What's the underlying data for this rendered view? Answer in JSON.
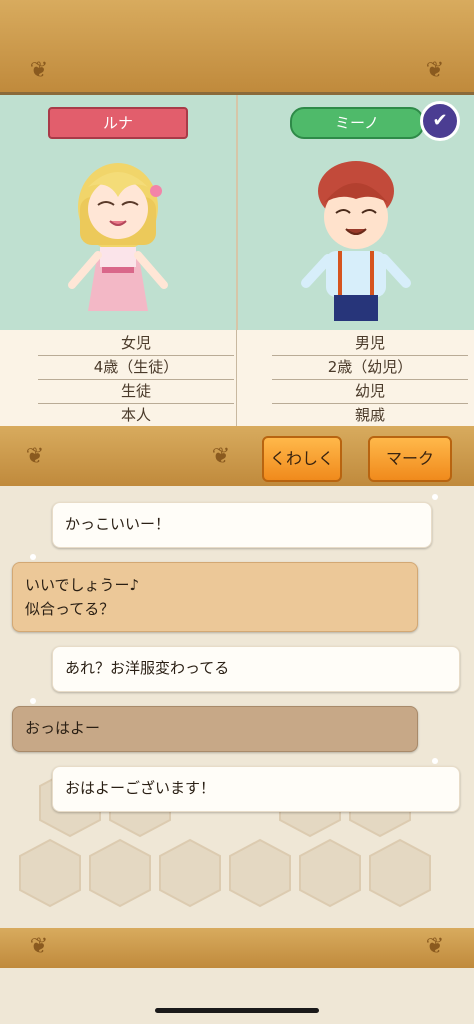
{
  "characters": {
    "left": {
      "name": "ルナ",
      "info": [
        "女児",
        "4歳（生徒）",
        "生徒",
        "本人"
      ]
    },
    "right": {
      "name": "ミーノ",
      "info": [
        "男児",
        "2歳（幼児）",
        "幼児",
        "親戚"
      ]
    }
  },
  "buttons": {
    "detail": "くわしく",
    "mark": "マーク"
  },
  "messages": [
    {
      "text": "かっこいいー！",
      "style": "white"
    },
    {
      "text": "いいでしょうー♪",
      "text2": "似合ってる？",
      "style": "tan"
    },
    {
      "text": "あれ？お洋服変わってる",
      "style": "white"
    },
    {
      "text": "おっはよー",
      "style": "brown"
    },
    {
      "text": "おはよーございます！",
      "style": "white"
    }
  ],
  "colors": {
    "frame": "#c99a4a",
    "luna_tag": "#e25e6c",
    "mino_tag": "#4fba6a",
    "button": "#f49a2a",
    "panel": "#bfe0d0"
  }
}
